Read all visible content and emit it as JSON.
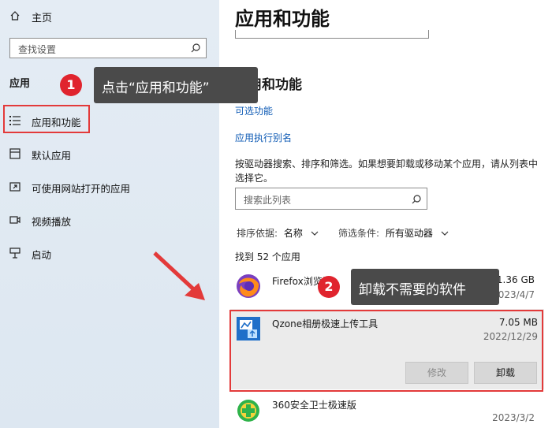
{
  "sidebar": {
    "home_label": "主页",
    "search_placeholder": "查找设置",
    "section_label": "应用",
    "items": [
      {
        "label": "应用和功能",
        "icon": "list-icon"
      },
      {
        "label": "默认应用",
        "icon": "default-apps-icon"
      },
      {
        "label": "可使用网站打开的应用",
        "icon": "web-open-icon"
      },
      {
        "label": "视频播放",
        "icon": "video-icon"
      },
      {
        "label": "启动",
        "icon": "startup-icon"
      }
    ]
  },
  "main": {
    "page_title": "应用和功能",
    "section_title": "应用和功能",
    "links": [
      "可选功能",
      "应用执行别名"
    ],
    "description": "按驱动器搜索、排序和筛选。如果想要卸载或移动某个应用，请从列表中选择它。",
    "search_placeholder": "搜索此列表",
    "sort_label": "排序依据:",
    "sort_value": "名称",
    "filter_label": "筛选条件:",
    "filter_value": "所有驱动器",
    "count_text": "找到 52 个应用",
    "apps": [
      {
        "name": "Firefox浏览器",
        "size": "1.36 GB",
        "date": "2023/4/7",
        "icon": "firefox-icon"
      },
      {
        "name": "Qzone相册极速上传工具",
        "size": "7.05 MB",
        "date": "2022/12/29",
        "icon": "qzone-upload-icon",
        "modify_label": "修改",
        "uninstall_label": "卸载"
      },
      {
        "name": "360安全卫士极速版",
        "size": "",
        "date": "2023/3/2",
        "icon": "360-security-icon"
      }
    ]
  },
  "annotations": {
    "step1_number": "1",
    "step1_text": "点击“应用和功能”",
    "step2_number": "2",
    "step2_text": "卸载不需要的软件"
  },
  "colors": {
    "accent_red": "#e33a3a",
    "link_blue": "#0f5bb5",
    "callout_bg": "#4a4a4a"
  }
}
